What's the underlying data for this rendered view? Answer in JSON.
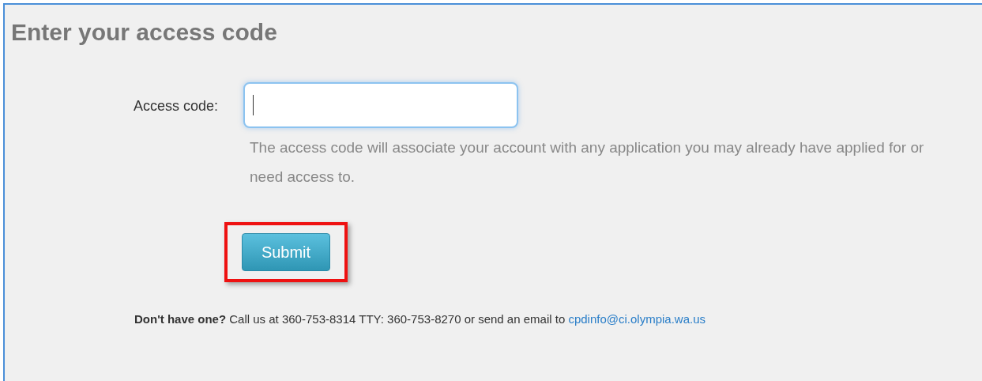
{
  "heading": "Enter your access code",
  "field": {
    "label": "Access code:",
    "help": "The access code will associate your account with any application you may already have applied for or need access to."
  },
  "submit": {
    "label": "Submit",
    "highlighted": true
  },
  "footer": {
    "text": "**Don't have one?** Call us at 360-753-8314 TTY: 360-753-8270 or send an email to",
    "link": "cpdinfo@ci.olympia.wa.us"
  }
}
